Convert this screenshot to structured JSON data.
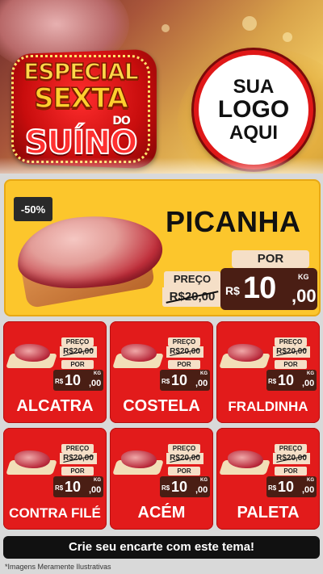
{
  "header": {
    "title_line1": "ESPECIAL",
    "title_line2": "SEXTA",
    "title_line3": "DO",
    "title_line4": "SUÍNO",
    "logo_line1": "SUA",
    "logo_line2": "LOGO",
    "logo_line3": "AQUI"
  },
  "featured": {
    "discount": "-50%",
    "name": "PICANHA",
    "old_label": "PREÇO",
    "old_price": "R$20,00",
    "new_label": "POR",
    "currency": "R$",
    "new_int": "10",
    "new_dec": ",00",
    "unit": "KG"
  },
  "products": [
    {
      "name": "ALCATRA",
      "old_label": "PREÇO",
      "old_price": "R$20,00",
      "new_label": "POR",
      "currency": "R$",
      "new_int": "10",
      "new_dec": ",00",
      "unit": "KG"
    },
    {
      "name": "COSTELA",
      "old_label": "PREÇO",
      "old_price": "R$20,00",
      "new_label": "POR",
      "currency": "R$",
      "new_int": "10",
      "new_dec": ",00",
      "unit": "KG"
    },
    {
      "name": "FRALDINHA",
      "old_label": "PREÇO",
      "old_price": "R$20,00",
      "new_label": "POR",
      "currency": "R$",
      "new_int": "10",
      "new_dec": ",00",
      "unit": "KG"
    },
    {
      "name": "CONTRA FILÉ",
      "old_label": "PREÇO",
      "old_price": "R$20,00",
      "new_label": "POR",
      "currency": "R$",
      "new_int": "10",
      "new_dec": ",00",
      "unit": "KG"
    },
    {
      "name": "ACÉM",
      "old_label": "PREÇO",
      "old_price": "R$20,00",
      "new_label": "POR",
      "currency": "R$",
      "new_int": "10",
      "new_dec": ",00",
      "unit": "KG"
    },
    {
      "name": "PALETA",
      "old_label": "PREÇO",
      "old_price": "R$20,00",
      "new_label": "POR",
      "currency": "R$",
      "new_int": "10",
      "new_dec": ",00",
      "unit": "KG"
    }
  ],
  "footer": {
    "cta": "Crie seu encarte com este tema!",
    "disclaimer": "*Imagens Meramente Ilustrativas"
  },
  "colors": {
    "card_red": "#e21b1b",
    "featured_yellow": "#fcc62c",
    "price_brown": "#4a1e14",
    "tag_cream": "#f5dfc7"
  }
}
